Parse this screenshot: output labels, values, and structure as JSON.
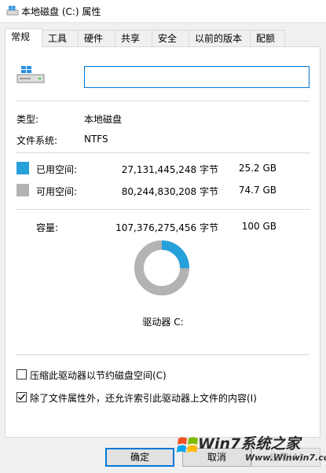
{
  "window": {
    "title": "本地磁盘 (C:) 属性"
  },
  "tabs": [
    "常规",
    "工具",
    "硬件",
    "共享",
    "安全",
    "以前的版本",
    "配额"
  ],
  "name_field": {
    "value": ""
  },
  "info": {
    "type_label": "类型:",
    "type_value": "本地磁盘",
    "fs_label": "文件系统:",
    "fs_value": "NTFS"
  },
  "space": {
    "used_label": "已用空间:",
    "used_bytes": "27,131,445,248 字节",
    "used_size": "25.2 GB",
    "used_color": "#26a0da",
    "free_label": "可用空间:",
    "free_bytes": "80,244,830,208 字节",
    "free_size": "74.7 GB",
    "free_color": "#b3b3b3",
    "capacity_label": "容量:",
    "capacity_bytes": "107,376,275,456 字节",
    "capacity_size": "100 GB"
  },
  "drive_label": "驱动器 C:",
  "options": {
    "compress_label": "压缩此驱动器以节约磁盘空间(C)",
    "compress_checked": false,
    "index_label": "除了文件属性外，还允许索引此驱动器上文件的内容(I)",
    "index_checked": true
  },
  "buttons": {
    "ok": "确定",
    "cancel": "取消",
    "apply": "应用(A)"
  },
  "watermark": {
    "line1": "Win7系统之家",
    "line2": "Www.Winwin7.com"
  },
  "chart_data": {
    "type": "pie",
    "categories": [
      "已用空间",
      "可用空间"
    ],
    "values": [
      27131445248,
      80244830208
    ],
    "colors": [
      "#26a0da",
      "#b3b3b3"
    ]
  }
}
